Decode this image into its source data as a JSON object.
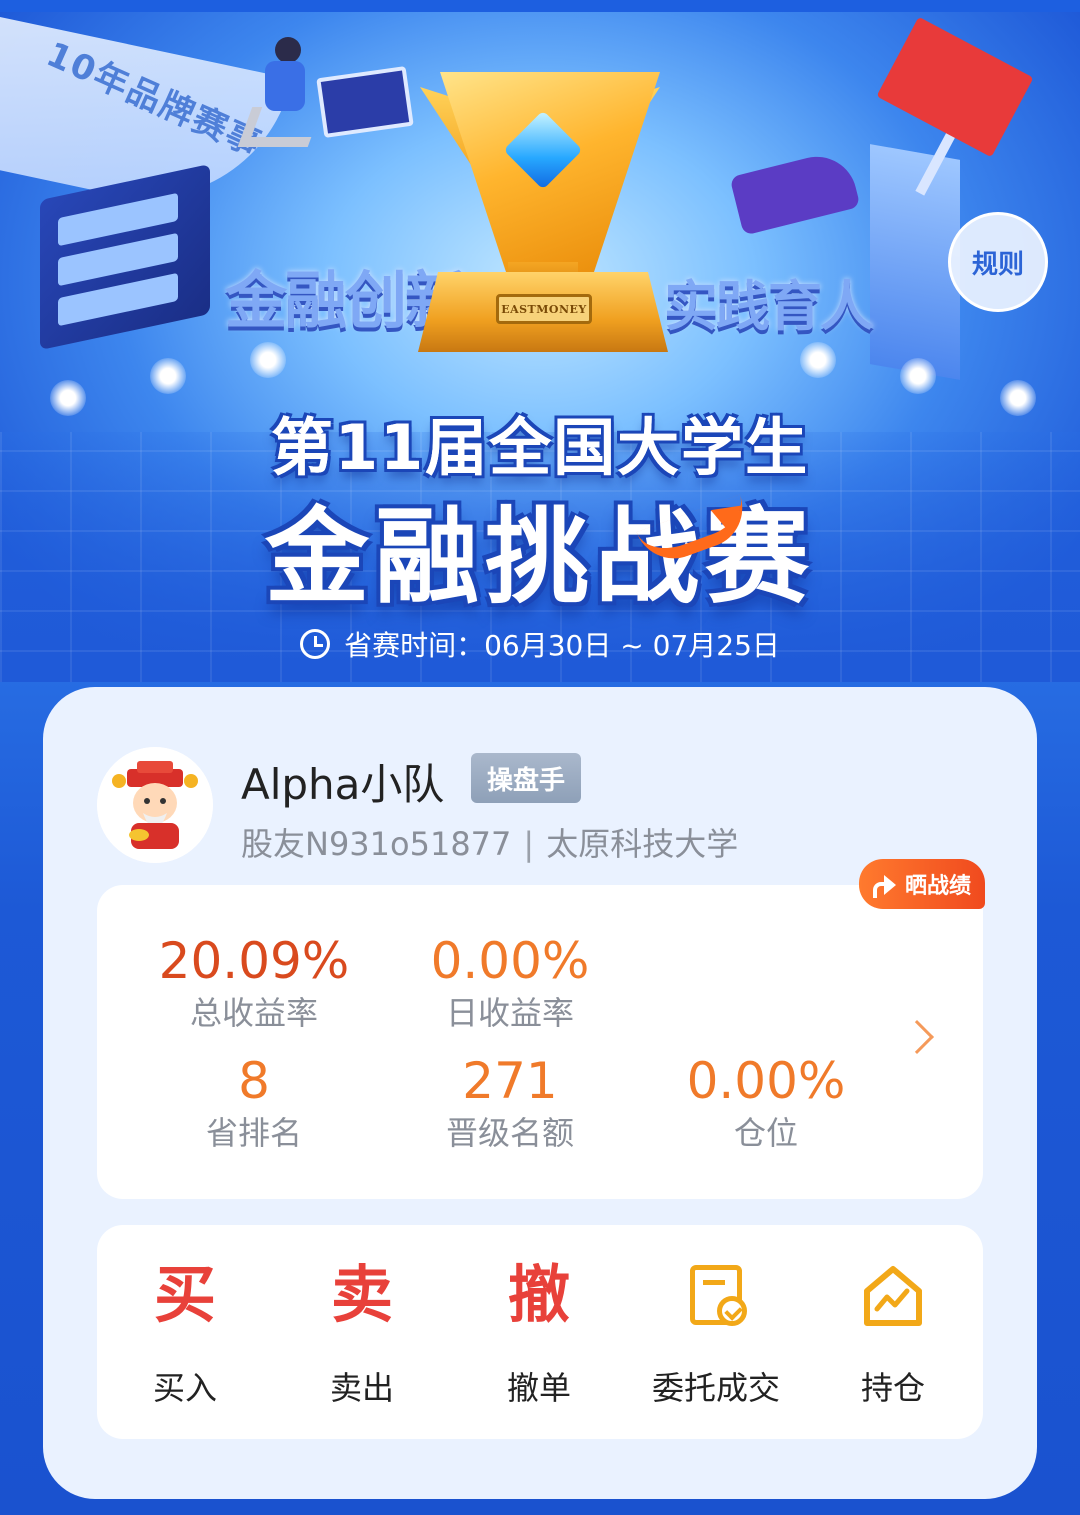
{
  "banner": {
    "rule_label": "规则",
    "title_line1": "第11届全国大学生",
    "title_line2": "金融挑战赛",
    "side_left": "金融创新",
    "side_right": "实践育人",
    "ribbon_text": "10年品牌赛事",
    "trophy_plate": "EASTMONEY",
    "time_label": "省赛时间：",
    "time_value": "06月30日 ~ 07月25日"
  },
  "profile": {
    "team_name": "Alpha小队",
    "role": "操盘手",
    "user_id": "股友N931o51877",
    "separator": "|",
    "school": "太原科技大学"
  },
  "stats": {
    "share_label": "晒战绩",
    "items": [
      {
        "value": "20.09%",
        "label": "总收益率"
      },
      {
        "value": "0.00%",
        "label": "日收益率"
      },
      {
        "value": "8",
        "label": "省排名"
      },
      {
        "value": "271",
        "label": "晋级名额"
      },
      {
        "value": "0.00%",
        "label": "仓位"
      }
    ]
  },
  "actions": [
    {
      "glyph": "买",
      "label": "买入"
    },
    {
      "glyph": "卖",
      "label": "卖出"
    },
    {
      "glyph": "撤",
      "label": "撤单"
    },
    {
      "icon": "order-doc-icon",
      "label": "委托成交"
    },
    {
      "icon": "holding-house-icon",
      "label": "持仓"
    }
  ],
  "colors": {
    "primary_blue": "#1f5ad8",
    "accent_orange": "#f07a2a",
    "accent_red": "#e8413a",
    "gold": "#f2a818"
  }
}
